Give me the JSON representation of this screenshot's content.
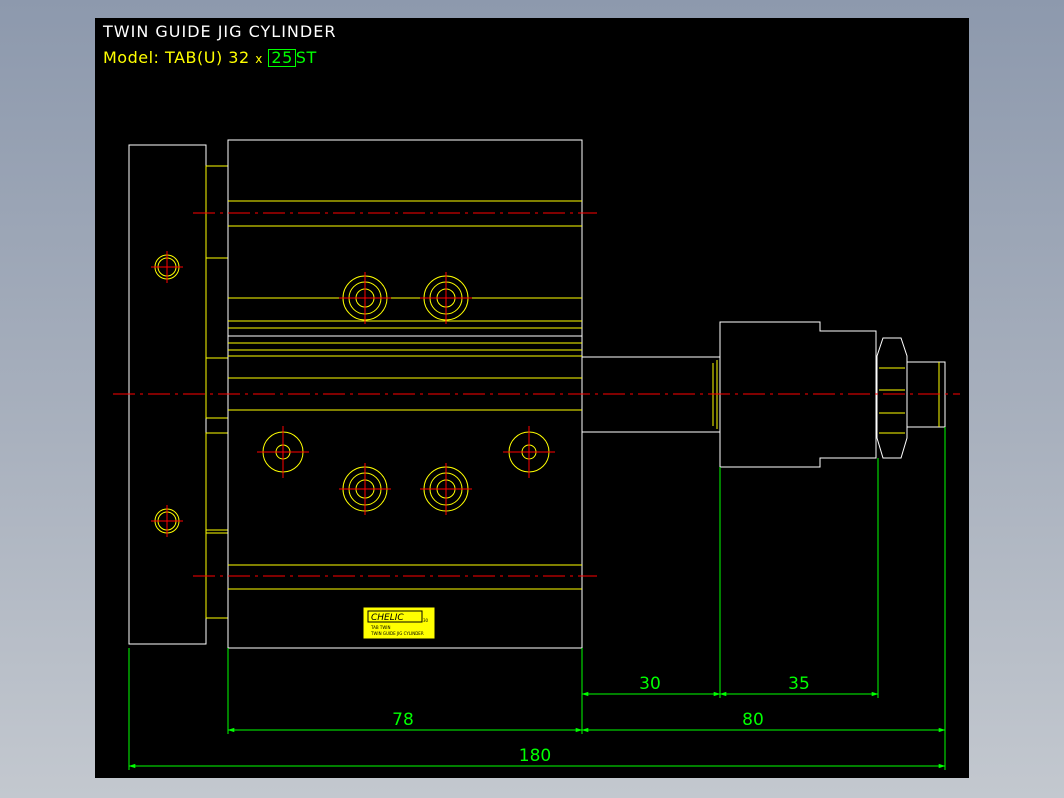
{
  "drawing": {
    "title": "TWIN  GUIDE  JIG  CYLINDER",
    "model_label": "Model:",
    "model_code": "TAB(U)  32",
    "model_times": "x",
    "stroke": "25",
    "stroke_unit": "ST"
  },
  "dimensions": {
    "d30": "30",
    "d35": "35",
    "d78": "78",
    "d80": "80",
    "d180": "180"
  },
  "nameplate": {
    "brand": "CHELIC",
    "brand_suffix": "30",
    "line1": "TAB  TWIN",
    "line2": "TWIN GUIDE JIG CYLINDER"
  },
  "colors": {
    "outline": "#ffffff",
    "part_lines": "#ffff00",
    "centerline": "#ff0000",
    "dimension": "#00ff00",
    "background": "#000000"
  }
}
